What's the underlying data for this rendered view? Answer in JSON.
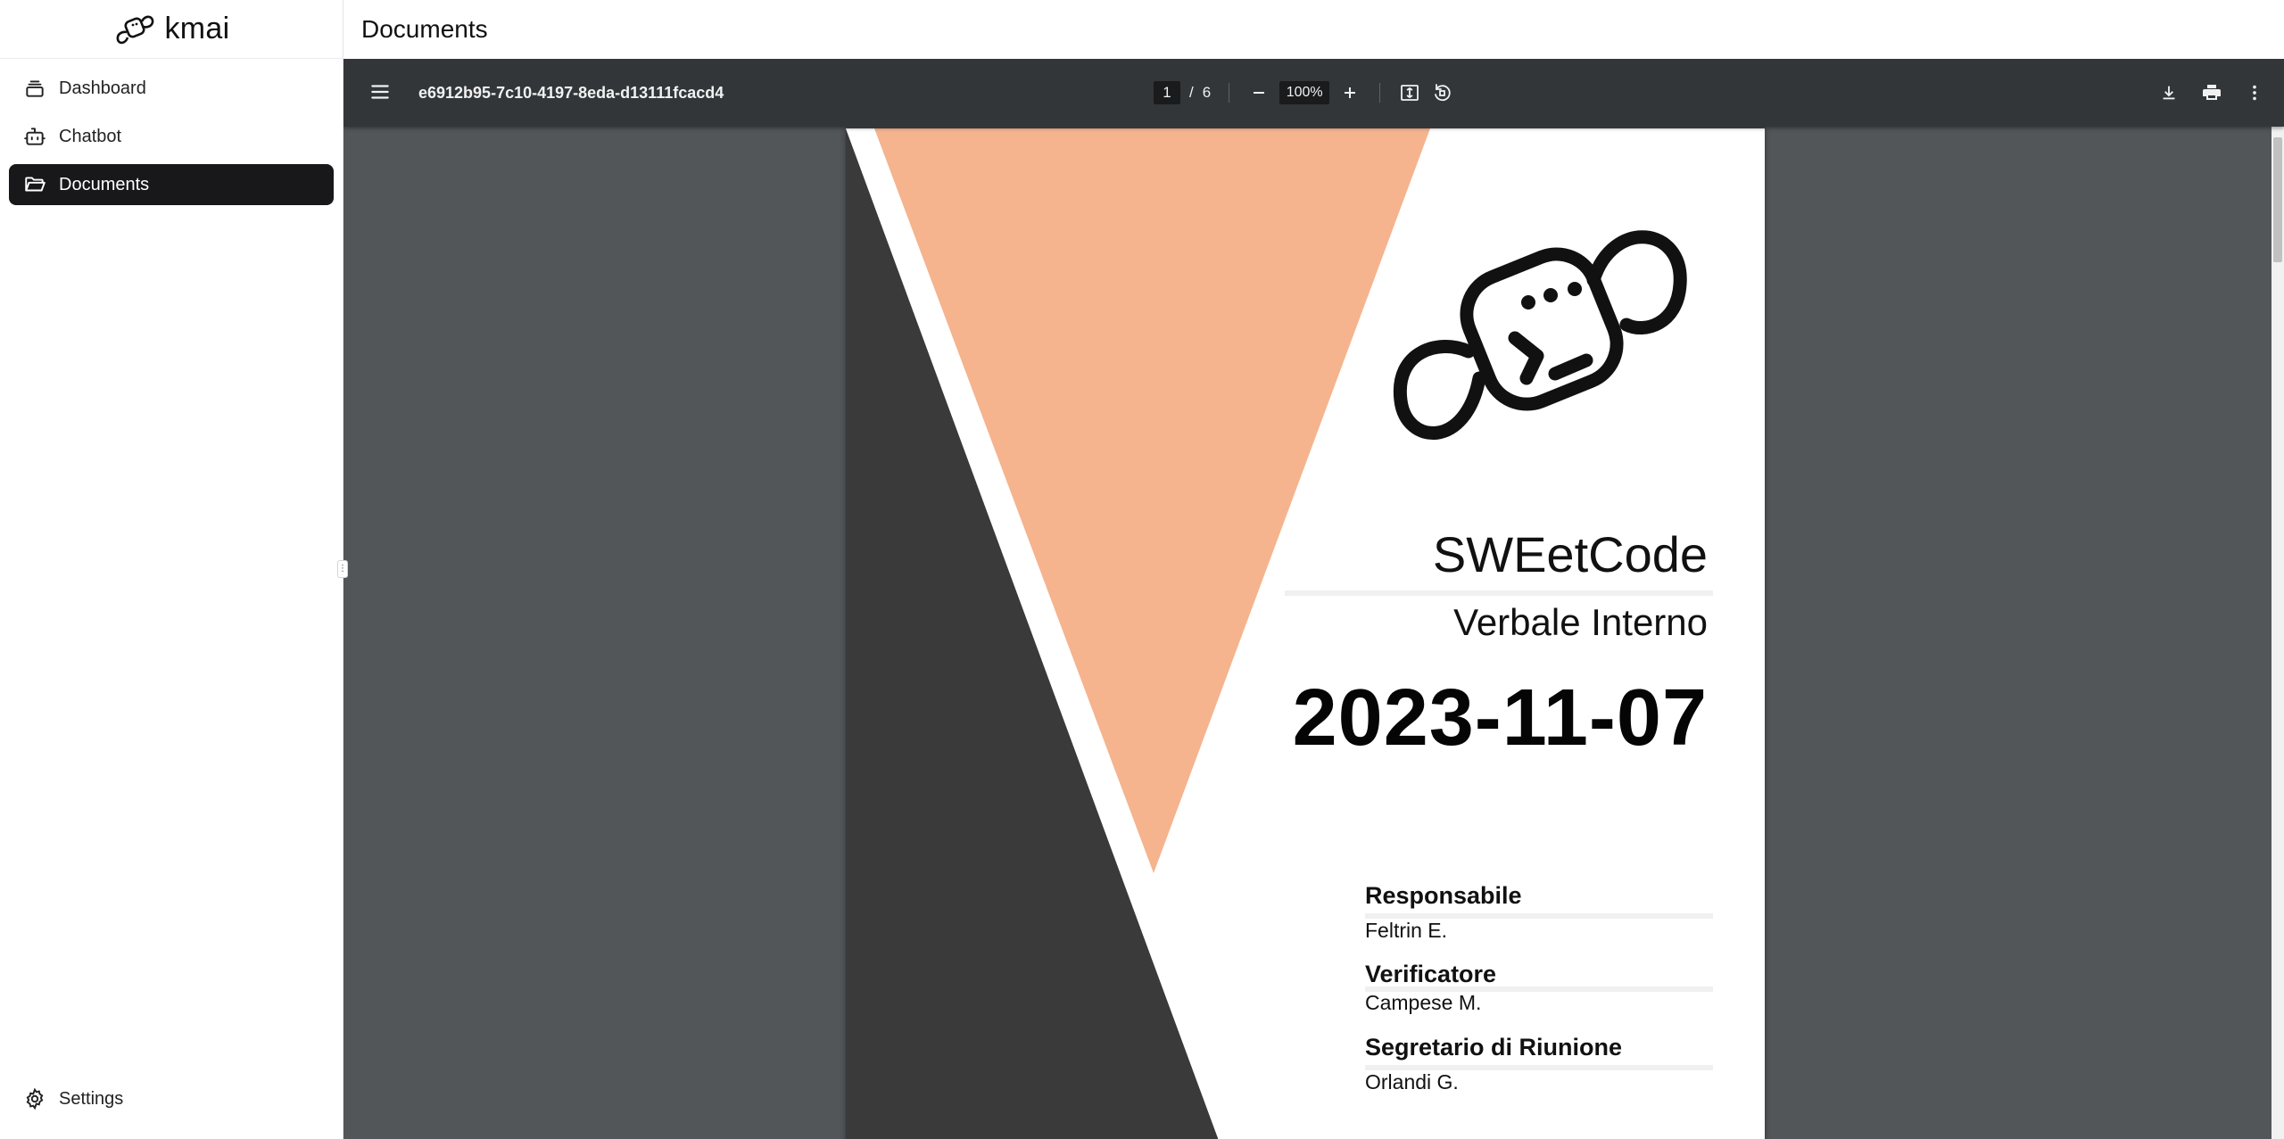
{
  "app": {
    "name": "kmai"
  },
  "sidebar": {
    "items": [
      {
        "label": "Dashboard",
        "icon": "layers-icon"
      },
      {
        "label": "Chatbot",
        "icon": "bot-icon"
      },
      {
        "label": "Documents",
        "icon": "folder-open-icon",
        "active": true
      }
    ],
    "settings_label": "Settings"
  },
  "header": {
    "title": "Documents"
  },
  "viewer": {
    "filename": "e6912b95-7c10-4197-8eda-d13111fcacd4",
    "current_page": "1",
    "page_separator": "/",
    "total_pages": "6",
    "zoom": "100%"
  },
  "document": {
    "team": "SWEetCode",
    "doc_type": "Verbale Interno",
    "date": "2023-11-07",
    "roles": [
      {
        "role": "Responsabile",
        "name": "Feltrin E."
      },
      {
        "role": "Verificatore",
        "name": "Campese M."
      },
      {
        "role": "Segretario di Riunione",
        "name": "Orlandi G."
      }
    ]
  },
  "colors": {
    "accent_peach": "#f5b48e",
    "dark_shape": "#3a3a3a",
    "toolbar": "#323639",
    "viewer_bg": "#525659",
    "active_nav": "#18181b"
  }
}
